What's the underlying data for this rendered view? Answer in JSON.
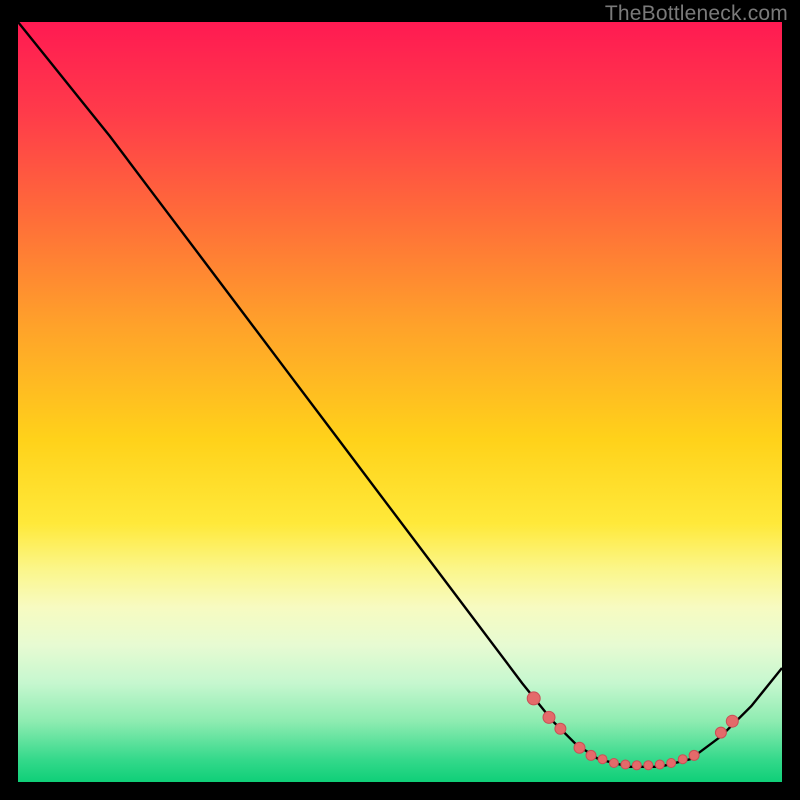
{
  "watermark": "TheBottleneck.com",
  "colors": {
    "curve": "#000000",
    "dot_fill": "#e46a6a",
    "dot_stroke": "#c94f56"
  },
  "chart_data": {
    "type": "line",
    "title": "",
    "xlabel": "",
    "ylabel": "",
    "xlim": [
      0,
      100
    ],
    "ylim": [
      0,
      100
    ],
    "series": [
      {
        "name": "curve",
        "x": [
          0,
          4,
          8,
          12,
          18,
          24,
          30,
          36,
          42,
          48,
          54,
          60,
          66,
          70,
          73,
          76,
          80,
          84,
          88,
          92,
          96,
          100
        ],
        "y": [
          100,
          95,
          90,
          85,
          77,
          69,
          61,
          53,
          45,
          37,
          29,
          21,
          13,
          8,
          5,
          3,
          2,
          2,
          3,
          6,
          10,
          15
        ]
      }
    ],
    "dots": {
      "name": "markers",
      "x": [
        67.5,
        69.5,
        71.0,
        73.5,
        75.0,
        76.5,
        78.0,
        79.5,
        81.0,
        82.5,
        84.0,
        85.5,
        87.0,
        88.5,
        92.0,
        93.5
      ],
      "y": [
        11.0,
        8.5,
        7.0,
        4.5,
        3.5,
        3.0,
        2.5,
        2.3,
        2.2,
        2.2,
        2.3,
        2.5,
        3.0,
        3.5,
        6.5,
        8.0
      ],
      "r": [
        6.5,
        6.0,
        5.5,
        5.5,
        5.0,
        4.5,
        4.5,
        4.5,
        4.5,
        4.5,
        4.5,
        4.5,
        4.5,
        5.0,
        5.5,
        6.0
      ]
    }
  }
}
